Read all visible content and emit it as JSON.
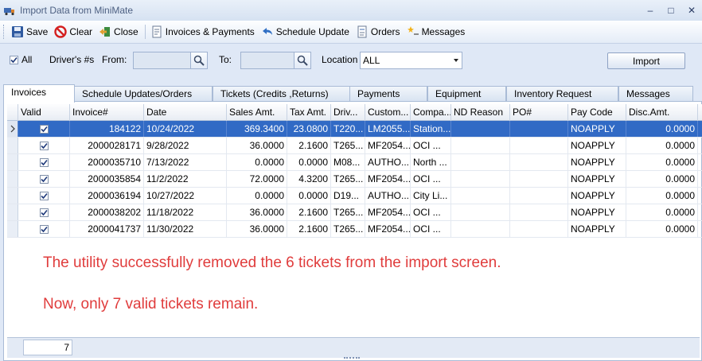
{
  "window": {
    "title": "Import Data from MiniMate",
    "minimize": "–",
    "maximize": "□",
    "close": "✕"
  },
  "toolbar": {
    "save": "Save",
    "clear": "Clear",
    "close": "Close",
    "invoices_payments": "Invoices & Payments",
    "schedule_update": "Schedule Update",
    "orders": "Orders",
    "messages": "Messages"
  },
  "filters": {
    "all_label": "All",
    "drivers_label": "Driver's #s",
    "from_label": "From:",
    "from_value": "",
    "to_label": "To:",
    "to_value": "",
    "location_label": "Location",
    "location_value": "ALL",
    "import_label": "Import"
  },
  "tabs": [
    {
      "label": "Invoices"
    },
    {
      "label": "Schedule Updates/Orders"
    },
    {
      "label": "Tickets (Credits ,Returns)"
    },
    {
      "label": "Payments"
    },
    {
      "label": "Equipment"
    },
    {
      "label": "Inventory Request"
    },
    {
      "label": "Messages"
    }
  ],
  "grid": {
    "columns": [
      "Valid",
      "Invoice#",
      "Date",
      "Sales Amt.",
      "Tax Amt.",
      "Driv...",
      "Custom...",
      "Compa...",
      "ND Reason",
      "PO#",
      "Pay Code",
      "Disc.Amt."
    ],
    "rows": [
      {
        "invoice": "184122",
        "date": "10/24/2022",
        "sales": "369.3400",
        "tax": "23.0800",
        "driver": "T220...",
        "customer": "LM2055...",
        "company": "Station...",
        "nd_reason": "",
        "po": "",
        "pay_code": "NOAPPLY",
        "disc": "0.0000"
      },
      {
        "invoice": "2000028171",
        "date": "9/28/2022",
        "sales": "36.0000",
        "tax": "2.1600",
        "driver": "T265...",
        "customer": "MF2054...",
        "company": "OCI     ...",
        "nd_reason": "",
        "po": "",
        "pay_code": "NOAPPLY",
        "disc": "0.0000"
      },
      {
        "invoice": "2000035710",
        "date": "7/13/2022",
        "sales": "0.0000",
        "tax": "0.0000",
        "driver": "M08...",
        "customer": "AUTHO...",
        "company": "North ...",
        "nd_reason": "",
        "po": "",
        "pay_code": "NOAPPLY",
        "disc": "0.0000"
      },
      {
        "invoice": "2000035854",
        "date": "11/2/2022",
        "sales": "72.0000",
        "tax": "4.3200",
        "driver": "T265...",
        "customer": "MF2054...",
        "company": "OCI     ...",
        "nd_reason": "",
        "po": "",
        "pay_code": "NOAPPLY",
        "disc": "0.0000"
      },
      {
        "invoice": "2000036194",
        "date": "10/27/2022",
        "sales": "0.0000",
        "tax": "0.0000",
        "driver": "D19...",
        "customer": "AUTHO...",
        "company": "City Li...",
        "nd_reason": "",
        "po": "",
        "pay_code": "NOAPPLY",
        "disc": "0.0000"
      },
      {
        "invoice": "2000038202",
        "date": "11/18/2022",
        "sales": "36.0000",
        "tax": "2.1600",
        "driver": "T265...",
        "customer": "MF2054...",
        "company": "OCI     ...",
        "nd_reason": "",
        "po": "",
        "pay_code": "NOAPPLY",
        "disc": "0.0000"
      },
      {
        "invoice": "2000041737",
        "date": "11/30/2022",
        "sales": "36.0000",
        "tax": "2.1600",
        "driver": "T265...",
        "customer": "MF2054...",
        "company": "OCI     ...",
        "nd_reason": "",
        "po": "",
        "pay_code": "NOAPPLY",
        "disc": "0.0000"
      }
    ],
    "row_count": "7"
  },
  "notes": {
    "line1": "The utility successfully removed the 6 tickets from the import screen.",
    "line2": "Now, only 7 valid tickets remain."
  },
  "colors": {
    "selected_row": "#316ac5",
    "note_text": "#e03c3c",
    "chrome": "#dfe8f6"
  }
}
